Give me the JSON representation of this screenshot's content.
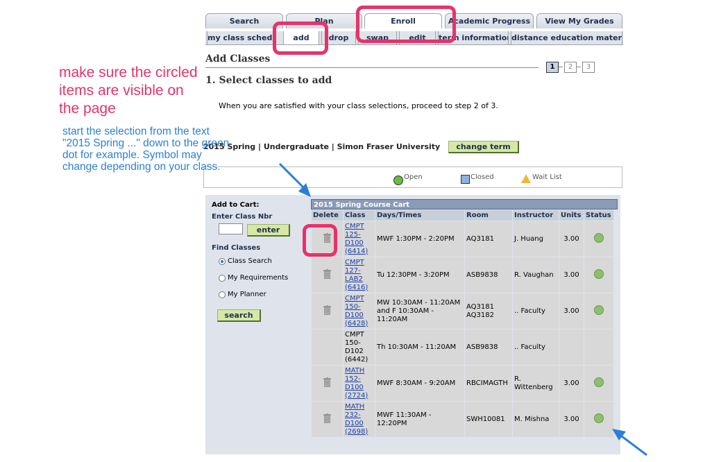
{
  "tabs": [
    "Search",
    "Plan",
    "Enroll",
    "Academic Progress",
    "View My Grades"
  ],
  "subtabs": [
    "my class schedule",
    "add",
    "drop",
    "swap",
    "edit",
    "term information",
    "distance education materials"
  ],
  "page": {
    "title": "Add Classes",
    "step_heading": "1.  Select classes to add",
    "instruction": "When you are satisfied with your class selections, proceed to step 2 of 3.",
    "steps": [
      "1",
      "2",
      "3"
    ],
    "term": "2015 Spring | Undergraduate | Simon Fraser University",
    "change_term": "change term"
  },
  "legend": {
    "open": "Open",
    "closed": "Closed",
    "wait": "Wait List"
  },
  "left": {
    "add_to_cart": "Add to Cart:",
    "enter_nbr": "Enter Class Nbr",
    "enter_btn": "enter",
    "find": "Find Classes",
    "radio1": "Class Search",
    "radio2": "My Requirements",
    "radio3": "My Planner",
    "search_btn": "search"
  },
  "cart": {
    "title": "2015 Spring Course Cart",
    "headers": [
      "Delete",
      "Class",
      "Days/Times",
      "Room",
      "Instructor",
      "Units",
      "Status"
    ],
    "rows": [
      {
        "has_trash": true,
        "class_lines": [
          "CMPT",
          "125-",
          "D100",
          "(6414)"
        ],
        "link": true,
        "days": "MWF 1:30PM - 2:20PM",
        "room": "AQ3181",
        "instructor": "J. Huang",
        "units": "3.00",
        "status": "Open"
      },
      {
        "has_trash": true,
        "class_lines": [
          "CMPT",
          "127-",
          "LAB2",
          "(6416)"
        ],
        "link": true,
        "days": "Tu 12:30PM - 3:20PM",
        "room": "ASB9838",
        "instructor": "R. Vaughan",
        "units": "3.00",
        "status": "Open"
      },
      {
        "has_trash": true,
        "class_lines": [
          "CMPT",
          "150-",
          "D100",
          "(6428)"
        ],
        "link": true,
        "days": "MW 10:30AM - 11:20AM and  F 10:30AM - 11:20AM",
        "room": "AQ3181 AQ3182",
        "instructor": ".. Faculty",
        "units": "3.00",
        "status": "Open"
      },
      {
        "has_trash": false,
        "class_lines": [
          "CMPT",
          "150-",
          "D102",
          "(6442)"
        ],
        "link": false,
        "days": "Th 10:30AM - 11:20AM",
        "room": "ASB9838",
        "instructor": ".. Faculty",
        "units": "",
        "status": ""
      },
      {
        "has_trash": true,
        "class_lines": [
          "MATH",
          "152-",
          "D100",
          "(2724)"
        ],
        "link": true,
        "days": "MWF 8:30AM - 9:20AM",
        "room": "RBCIMAGTH",
        "instructor": "R. Wittenberg",
        "units": "3.00",
        "status": "Open"
      },
      {
        "has_trash": true,
        "class_lines": [
          "MATH",
          "232-",
          "D100",
          "(2698)"
        ],
        "link": true,
        "days": "MWF 11:30AM - 12:20PM",
        "room": "SWH10081",
        "instructor": "M. Mishna",
        "units": "3.00",
        "status": "Open"
      }
    ]
  },
  "annotations": {
    "note1": "make sure the circled items are visible on the page",
    "note2": "start the selection from the text \"2015 Spring ...\" down to the green dot for example. Symbol may change depending on your class."
  },
  "colors": {
    "annotation_pink": "#e8326a",
    "annotation_blue": "#2b7fd6",
    "open_green": "#8dbf6e",
    "button_green": "#d6e7a6"
  }
}
